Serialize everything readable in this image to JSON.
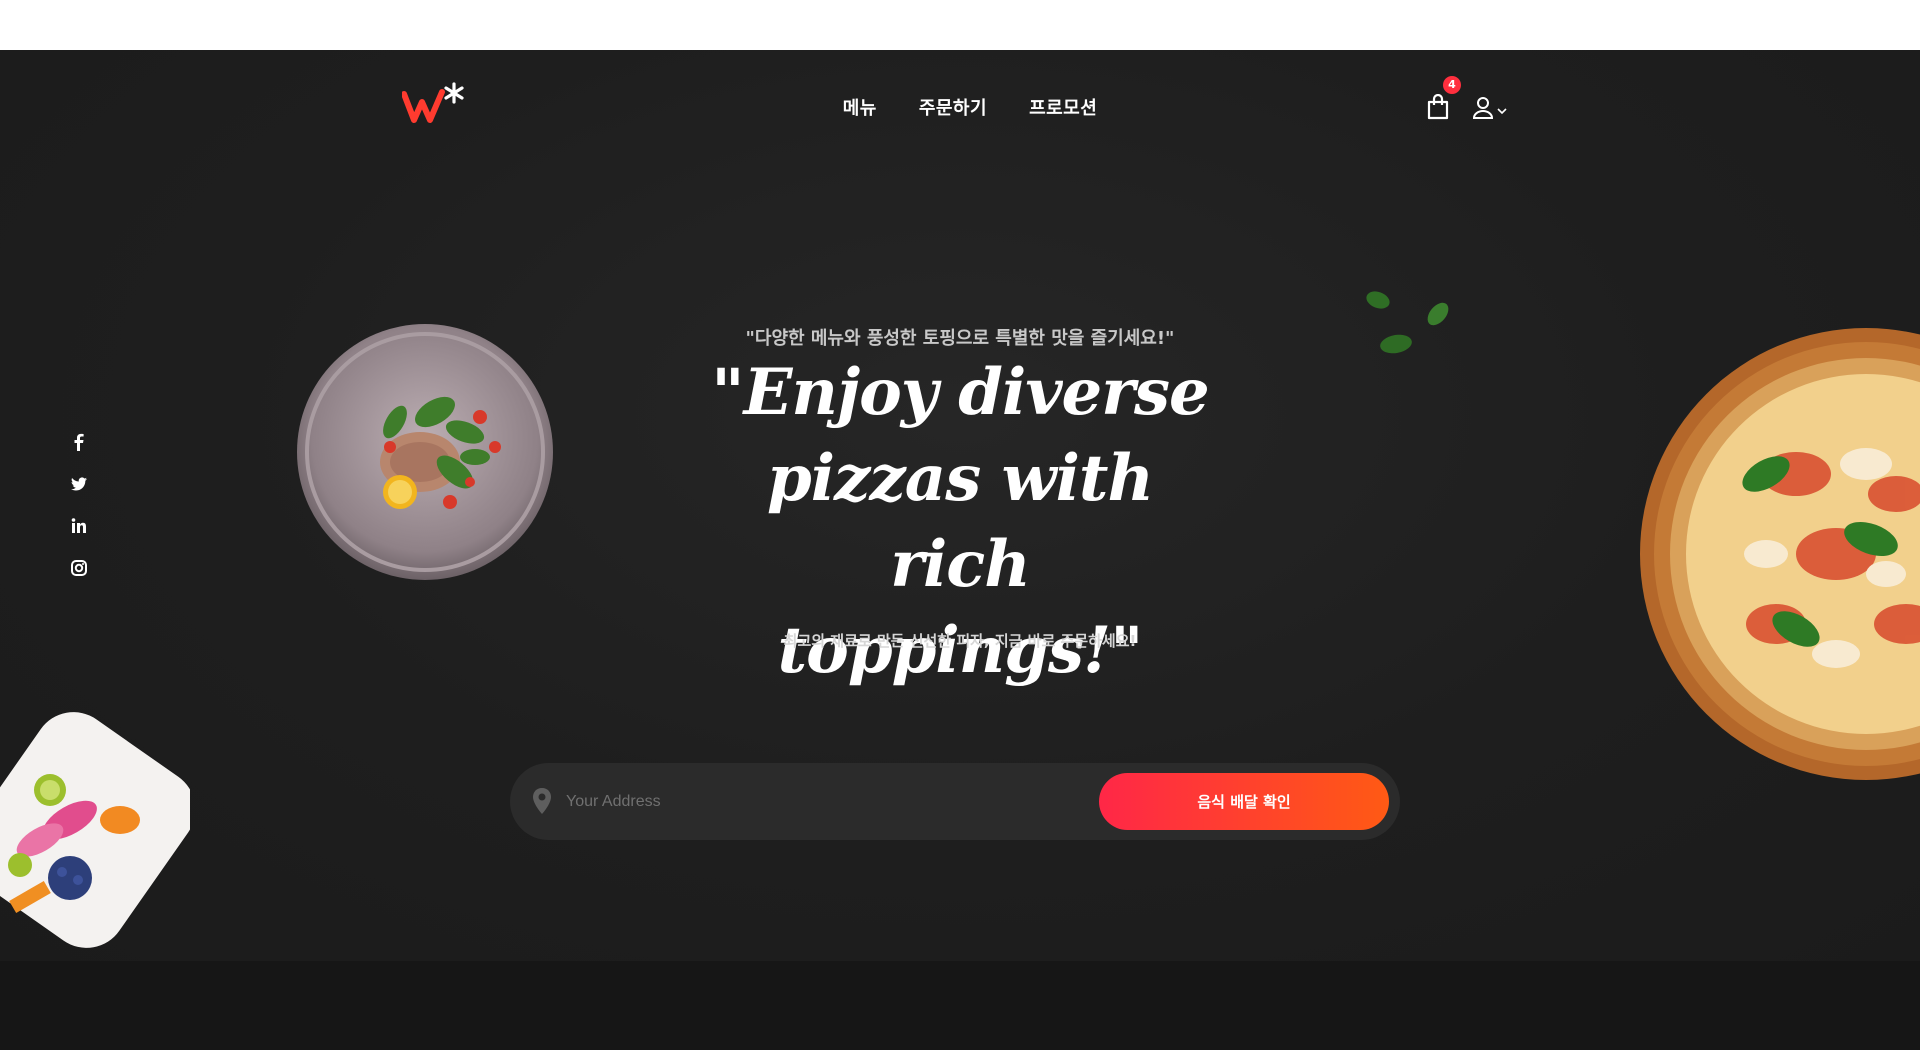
{
  "brand": {
    "logo_alt": "W* logo",
    "accent": "#ff3b2f"
  },
  "nav": {
    "items": [
      {
        "label": "메뉴"
      },
      {
        "label": "주문하기"
      },
      {
        "label": "프로모션"
      }
    ]
  },
  "header": {
    "cart_count": "4",
    "cart_icon": "shopping-bag-icon",
    "user_icon": "user-icon"
  },
  "social": {
    "icons": [
      "facebook-icon",
      "twitter-icon",
      "linkedin-icon",
      "instagram-icon"
    ]
  },
  "hero": {
    "subtitle": "\"다양한 메뉴와 풍성한 토핑으로 특별한 맛을 즐기세요!\"",
    "headline": "\"Enjoy diverse pizzas with rich toppings!\"",
    "tagline": "최고의 재료로 만든 신선한 피자, 지금 바로 주문하세요!"
  },
  "address": {
    "placeholder": "Your Address",
    "value": "",
    "button_label": "음식 배달 확인"
  },
  "colors": {
    "background": "#1e1e1e",
    "button_start": "#ff2747",
    "button_end": "#ff5a14"
  }
}
